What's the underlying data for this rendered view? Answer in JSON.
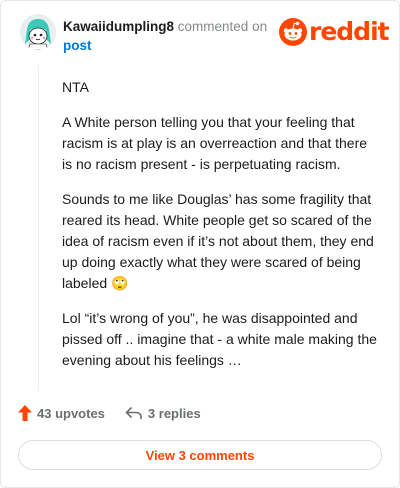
{
  "comment": {
    "author": "Kawaiidumpling8",
    "action_text": "commented on",
    "link_text": "post",
    "paragraphs": [
      "NTA",
      "A White person telling you that your feeling that racism is at play is an overreaction and that there is no racism present - is perpetuating racism.",
      "Sounds to me like Douglas’ has some fragility that reared its head. White people get so scared of the idea of racism even if it’s not about them, they end up doing exactly what they were scared of being labeled 🙄",
      "Lol “it’s wrong of you”, he was disappointed and pissed off .. imagine that - a white male making the evening about his feelings …"
    ]
  },
  "brand": {
    "wordmark": "reddit",
    "color": "#ff4500"
  },
  "actions": {
    "upvotes": "43 upvotes",
    "replies": "3 replies",
    "view_comments": "View 3 comments"
  },
  "icons": {
    "avatar": "snoo-avatar-icon",
    "logo": "reddit-alien-icon",
    "upvote": "upvote-arrow-icon",
    "reply": "reply-arrow-icon"
  }
}
